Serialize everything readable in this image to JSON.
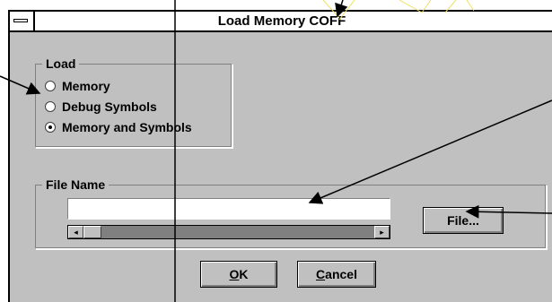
{
  "dialog": {
    "title": "Load Memory COFF"
  },
  "load_group": {
    "label": "Load",
    "options": [
      {
        "label": "Memory",
        "checked": false
      },
      {
        "label": "Debug Symbols",
        "checked": false
      },
      {
        "label": "Memory and Symbols",
        "checked": true
      }
    ]
  },
  "file_group": {
    "label": "File Name",
    "file_name_value": "",
    "scroll_left_glyph": "◂",
    "scroll_right_glyph": "▸"
  },
  "buttons": {
    "file": "File...",
    "ok_accel": "O",
    "ok_rest": "K",
    "cancel_accel": "C",
    "cancel_rest": "ancel"
  },
  "icons": {
    "system_menu": "system-menu-icon",
    "scroll_left": "scroll-left-arrow-icon",
    "scroll_right": "scroll-right-arrow-icon",
    "annotation_arrows": "callout-arrow-icon"
  }
}
